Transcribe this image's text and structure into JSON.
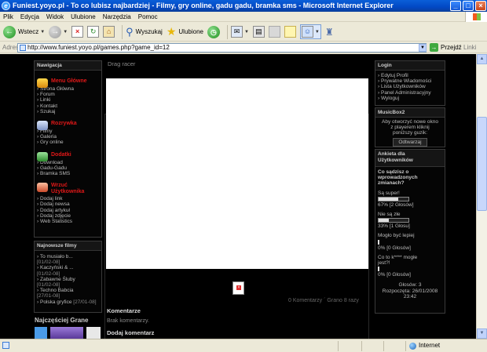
{
  "window": {
    "title": "Funiest.yoyo.pl - To co lubisz najbardziej - Filmy, gry online, gadu gadu, bramka sms - Microsoft Internet Explorer"
  },
  "menubar": [
    "Plik",
    "Edycja",
    "Widok",
    "Ulubione",
    "Narzędzia",
    "Pomoc"
  ],
  "toolbar": {
    "back_label": "Wstecz",
    "search_label": "Wyszukaj",
    "favorites_label": "Ulubione"
  },
  "address": {
    "label": "Adres",
    "url": "http://www.funiest.yoyo.pl/games.php?game_id=12",
    "go_label": "Przejdź",
    "links_label": "Linki"
  },
  "navigation": {
    "header": "Nawigacja",
    "sections": [
      {
        "title": "Menu Główne",
        "items": [
          "Strona Główna",
          "Forum",
          "Linki",
          "Kontakt",
          "Szukaj"
        ]
      },
      {
        "title": "Rozrywka",
        "items": [
          "Filmy",
          "Galeria",
          "Gry online"
        ]
      },
      {
        "title": "Dodatki",
        "items": [
          "Download",
          "Gadu-Gadu",
          "Bramka SMS"
        ]
      },
      {
        "title": "Wrzuć Użytkownika",
        "items": [
          "Dodaj link",
          "Dodaj newsa",
          "Dodaj artykuł",
          "Dodaj zdjęcie",
          "Web Statistics"
        ]
      }
    ]
  },
  "latest_films": {
    "header": "Najnowsze filmy",
    "items": [
      {
        "title": "To musiało b...",
        "date": "[01/02-08]"
      },
      {
        "title": "Kaczyński & ...",
        "date": "[01/02-08]"
      },
      {
        "title": "Zabawne Śluby",
        "date": "[01/02-08]"
      },
      {
        "title": "Techno Babcia",
        "date": "[27/01-08]"
      },
      {
        "title": "Polska gryfice",
        "date": "[27/01-08]"
      }
    ]
  },
  "most_played_header": "Najczęściej Grane",
  "game": {
    "title": "Drag racer",
    "comments_count": "0 Komentarzy",
    "played": "Grano 8 razy"
  },
  "comments": {
    "header": "Komentarze",
    "empty": "Brak komentarzy.",
    "add_header": "Dodaj komentarz"
  },
  "login": {
    "header": "Login",
    "items": [
      "Edytuj Profil",
      "Prywatne Wiadomości",
      "Lista Użytkowników",
      "Panel Administracyjny",
      "Wyloguj"
    ]
  },
  "musicbox": {
    "header": "MusicBox2",
    "text_lines": [
      "Aby otworzyć nowe okno",
      "z playerem kliknij",
      "poniższy guzik:"
    ],
    "button": "Odtwarzaj"
  },
  "poll": {
    "header_lines": [
      "Ankieta dla",
      "Użytkowników"
    ],
    "question_lines": [
      "Co sądzisz o",
      "wprowadzonych",
      "zmianach?"
    ],
    "options": [
      {
        "label": "Są super!",
        "result": "67% [2 Głosów]",
        "percent": 67
      },
      {
        "label": "Nie są złe",
        "result": "33% [1 Głosu]",
        "percent": 33
      },
      {
        "label": "Mogło być lepiej",
        "result": "0% [0 Głosów]",
        "percent": 0
      },
      {
        "label_lines": [
          "Co to k**** mogłe",
          "jest?!"
        ],
        "result": "0% [0 Głosów]",
        "percent": 0
      }
    ],
    "votes": "Głosów: 3",
    "started_lines": [
      "Rozpoczęta: 26/01/2008",
      "23:42"
    ]
  },
  "status": {
    "zone": "Internet"
  }
}
